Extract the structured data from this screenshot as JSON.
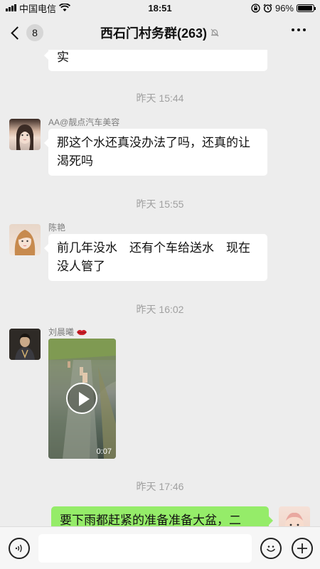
{
  "status_bar": {
    "carrier": "中国电信",
    "time": "18:51",
    "battery": "96%",
    "battery_level": 0.96
  },
  "header": {
    "back_count": "8",
    "title": "西石门村务群(263)"
  },
  "messages": {
    "m0_text": "实",
    "t1": "昨天 15:44",
    "m1_sender": "AA@靓点汽车美容",
    "m1_text": "那这个水还真没办法了吗，还真的让渴死吗",
    "t2": "昨天 15:55",
    "m2_sender": "陈艳",
    "m2_text": "前几年没水　还有个车给送水　现在没人管了",
    "t3": "昨天 16:02",
    "m3_sender": "刘晨曦",
    "m3_video_duration": "0:07",
    "t4": "昨天 17:46",
    "m4_text": "要下雨都赶紧的准备准备大盆，二"
  },
  "colors": {
    "background": "#ededed",
    "self_bubble": "#95ec69",
    "other_bubble": "#ffffff",
    "timestamp": "#a0a0a0"
  },
  "icons": [
    "back-chevron-icon",
    "mute-icon",
    "more-dots-icon",
    "voice-icon",
    "emoji-icon",
    "plus-icon",
    "play-icon",
    "lips-icon"
  ]
}
